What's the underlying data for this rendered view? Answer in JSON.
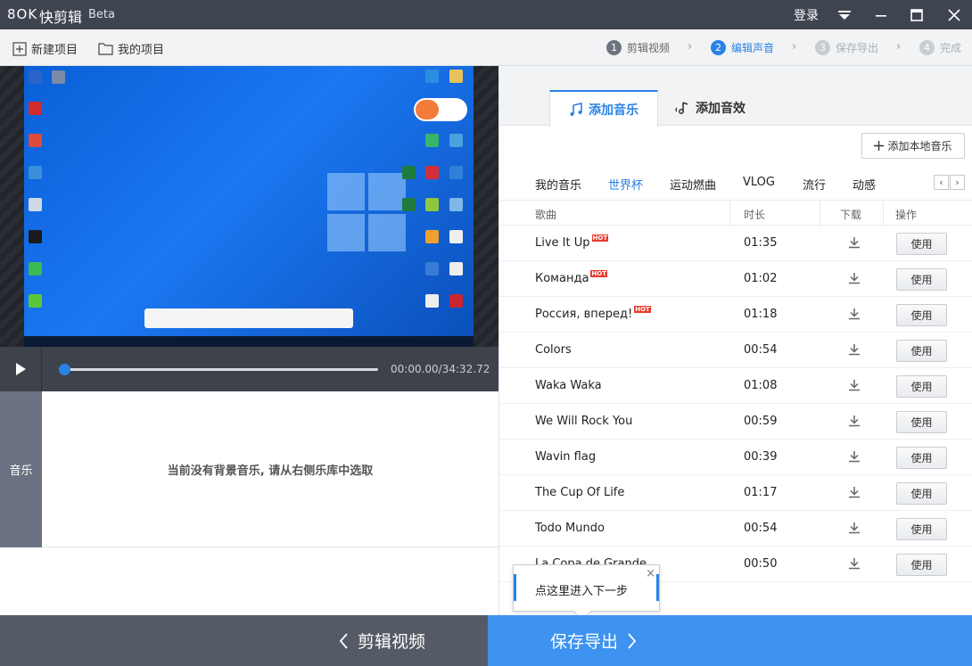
{
  "titlebar": {
    "logo": "8OK",
    "title": "快剪辑",
    "beta": "Beta",
    "login": "登录"
  },
  "toolbar": {
    "new_project": "新建项目",
    "my_projects": "我的项目",
    "steps": [
      {
        "num": "1",
        "label": "剪辑视频"
      },
      {
        "num": "2",
        "label": "编辑声音"
      },
      {
        "num": "3",
        "label": "保存导出"
      },
      {
        "num": "4",
        "label": "完成"
      }
    ]
  },
  "player": {
    "time": "00:00.00/34:32.72",
    "progress": 0
  },
  "music_track": {
    "label": "音乐",
    "empty_text": "当前没有背景音乐, 请从右侧乐库中选取"
  },
  "right_panel": {
    "tabs": [
      {
        "label": "添加音乐",
        "icon": "music-note-icon"
      },
      {
        "label": "添加音效",
        "icon": "sound-effect-icon"
      }
    ],
    "add_local": "添加本地音乐",
    "categories": [
      "我的音乐",
      "世界杯",
      "运动燃曲",
      "VLOG",
      "流行",
      "动感"
    ],
    "active_category": "世界杯",
    "columns": {
      "song": "歌曲",
      "duration": "时长",
      "download": "下载",
      "action": "操作"
    },
    "hot_label": "HOT",
    "use_label": "使用",
    "songs": [
      {
        "name": "Live It Up",
        "duration": "01:35",
        "hot": true
      },
      {
        "name": "Команда",
        "duration": "01:02",
        "hot": true
      },
      {
        "name": "Россия, вперед!",
        "duration": "01:18",
        "hot": true
      },
      {
        "name": "Colors",
        "duration": "00:54",
        "hot": false
      },
      {
        "name": "Waka Waka",
        "duration": "01:08",
        "hot": false
      },
      {
        "name": "We Will Rock You",
        "duration": "00:59",
        "hot": false
      },
      {
        "name": "Wavin flag",
        "duration": "00:39",
        "hot": false
      },
      {
        "name": "The Cup Of Life",
        "duration": "01:17",
        "hot": false
      },
      {
        "name": "Todo Mundo",
        "duration": "00:54",
        "hot": false
      },
      {
        "name": "La Copa de Grande",
        "duration": "00:50",
        "hot": false
      }
    ]
  },
  "tooltip": {
    "text": "点这里进入下一步",
    "close": "×"
  },
  "bottom": {
    "prev": "剪辑视频",
    "next": "保存导出"
  },
  "colors": {
    "accent": "#2a82e4",
    "next_button": "#3d93ef",
    "prev_button": "#555b66",
    "titlebar": "#3e4450",
    "hot": "#e83b2e"
  }
}
